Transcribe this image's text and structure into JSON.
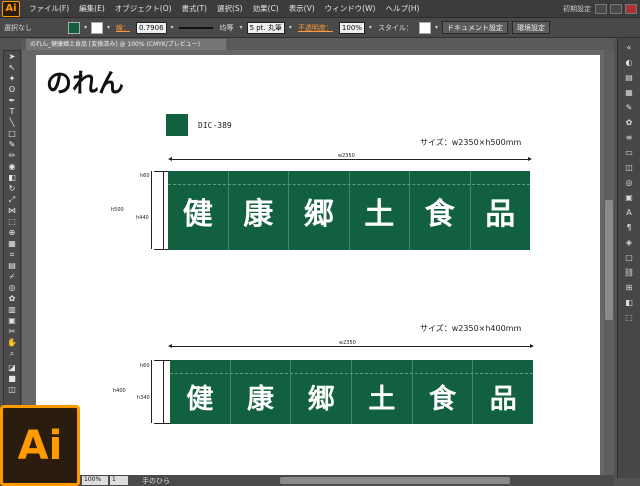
{
  "app": {
    "logo": "Ai",
    "menus": [
      "ファイル(F)",
      "編集(E)",
      "オブジェクト(O)",
      "書式(T)",
      "選択(S)",
      "効果(C)",
      "表示(V)",
      "ウィンドウ(W)",
      "ヘルプ(H)"
    ],
    "workspace": "初期設定"
  },
  "control_bar": {
    "selection": "選択なし",
    "fill_color": "#11603f",
    "stroke_label": "線：",
    "stroke_weight": "0.7906",
    "stroke_profile": "均等",
    "brush": "5 pt. 丸筆",
    "opacity_label": "不透明度：",
    "opacity": "100%",
    "style_label": "スタイル：",
    "doc_setup": "ドキュメント設定",
    "prefs": "環境設定"
  },
  "document_tab": "のれん_健康郷土食品 [変換済み] @ 100% (CMYK/プレビュー)",
  "status": {
    "zoom": "100%",
    "page": "1",
    "tool": "手のひら"
  },
  "artboard": {
    "title": "のれん",
    "swatch_label": "DIC-389",
    "swatch_color": "#11603f",
    "noren_text": [
      "健",
      "康",
      "郷",
      "土",
      "食",
      "品"
    ],
    "noren1": {
      "size": "サイズ：w2350×h500mm",
      "width_dim": "w2350",
      "h_total": "h500",
      "h_top": "h60",
      "h_body": "h440"
    },
    "noren2": {
      "size": "サイズ：w2350×h400mm",
      "width_dim": "w2350",
      "h_total": "h400",
      "h_top": "h60",
      "h_body": "h340"
    }
  }
}
